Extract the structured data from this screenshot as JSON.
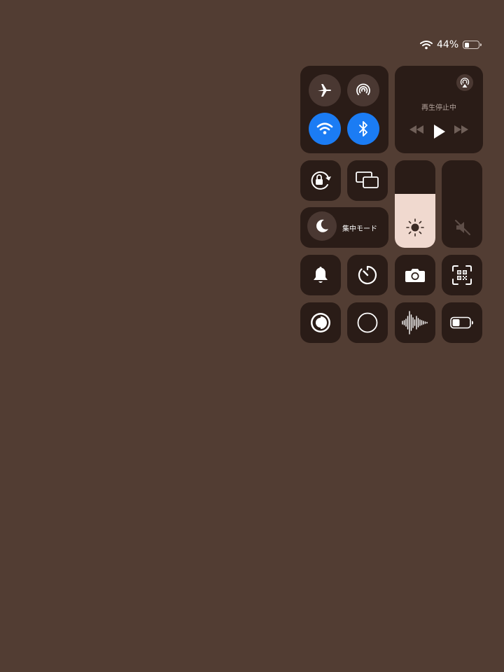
{
  "status": {
    "battery_text": "44%",
    "battery_level": 0.44
  },
  "connectivity": {
    "airplane": {
      "icon": "airplane-icon",
      "active": false
    },
    "airdrop": {
      "icon": "airdrop-icon",
      "active": false
    },
    "wifi": {
      "icon": "wifi-icon",
      "active": true
    },
    "bluetooth": {
      "icon": "bluetooth-icon",
      "active": true
    }
  },
  "media": {
    "status_label": "再生停止中",
    "airplay_icon": "airplay-icon"
  },
  "focus": {
    "label": "集中モード",
    "icon": "moon-icon"
  },
  "brightness": {
    "level": 0.62,
    "icon": "sun-icon"
  },
  "volume": {
    "level": 0.0,
    "icon": "speaker-muted-icon"
  },
  "colors": {
    "background": "#523d33",
    "tile": "#2a1c17",
    "accent": "#1b7cf4",
    "brightness_fill": "#f0d9cf"
  }
}
